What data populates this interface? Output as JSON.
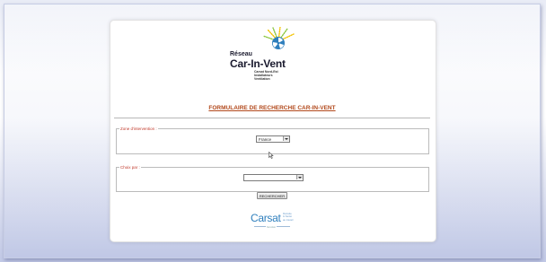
{
  "logo": {
    "reseau": "Réseau",
    "name": "Car-In-Vent",
    "subtitle": [
      "Carsat Nord-Est",
      "Installateurs",
      "Ventilation"
    ]
  },
  "form": {
    "title": "FORMULAIRE DE RECHERCHE CAR-IN-VENT",
    "zone_legend": "Zone d'intervention :",
    "zone_selected": "France",
    "choix_legend": "Choix par :",
    "choix_selected": "",
    "search_label": "RECHERCHER"
  },
  "footer": {
    "carsat": "Carsat",
    "carsat_sub": [
      "Retraite",
      "& Santé",
      "au travail"
    ],
    "carsat_tag": "Nord-Est"
  },
  "colors": {
    "title": "#b2491c",
    "legend": "#c0392b",
    "carsat": "#2f7fbd",
    "fan": [
      "#2f7fbd",
      "#8cc63f",
      "#f2c200"
    ]
  },
  "icons": {
    "logo": "fan-icon",
    "cursor": "mouse-cursor-icon",
    "dropdown": "chevron-down-icon"
  }
}
